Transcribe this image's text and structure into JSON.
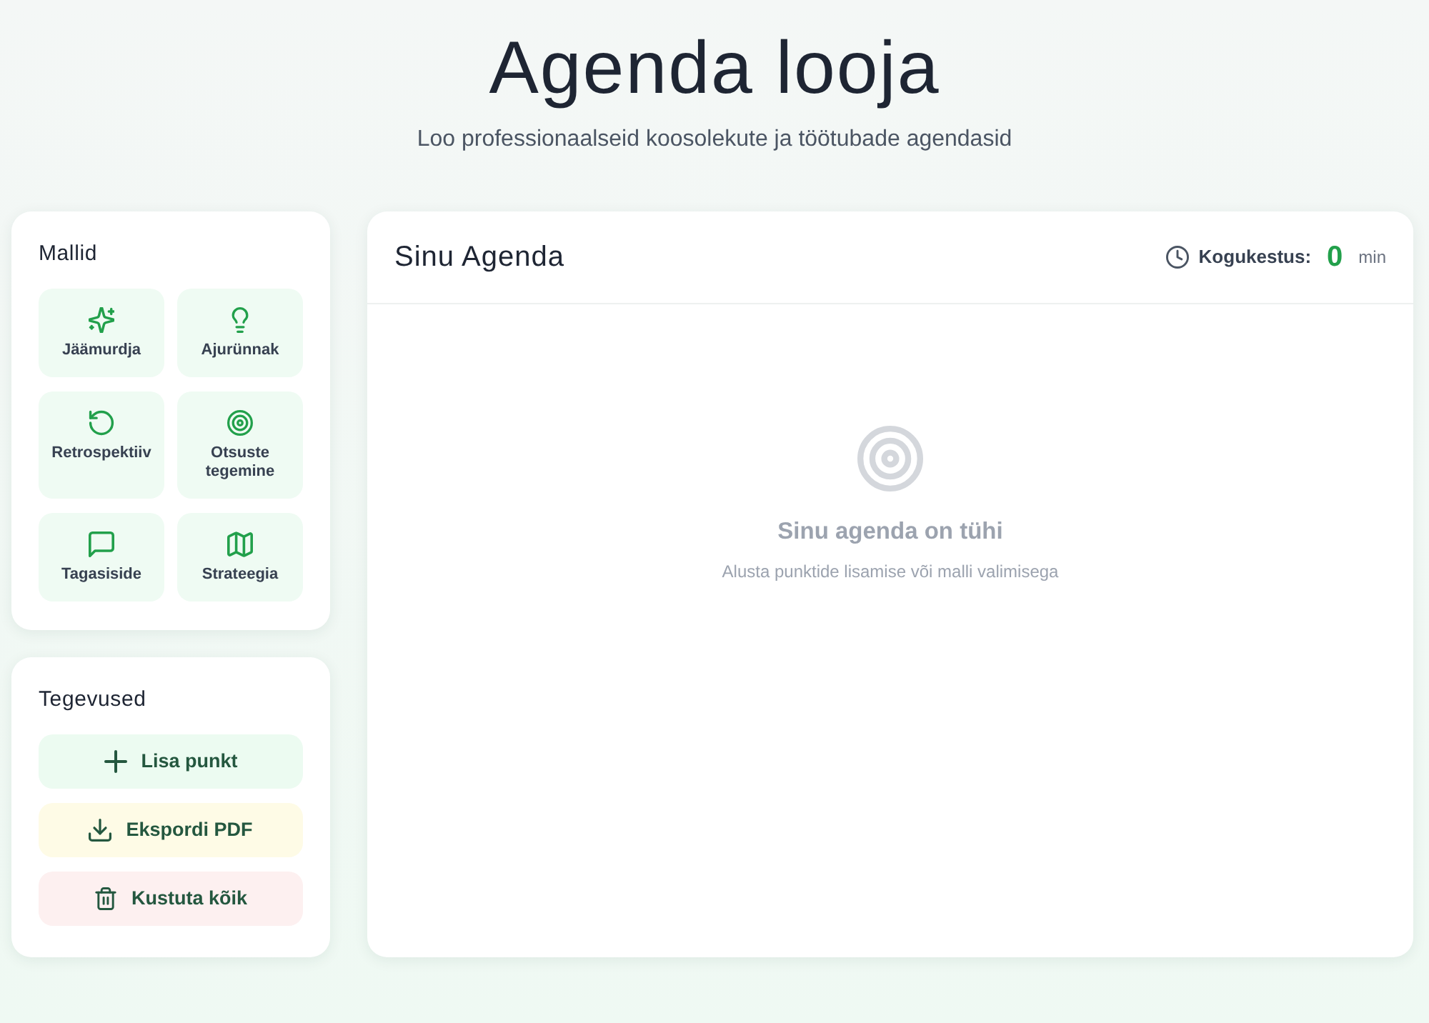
{
  "header": {
    "title": "Agenda looja",
    "subtitle": "Loo professionaalseid koosolekute ja töötubade agendasid"
  },
  "templates": {
    "title": "Mallid",
    "items": [
      {
        "label": "Jäämurdja",
        "kind": "sparkles"
      },
      {
        "label": "Ajurünnak",
        "kind": "bulb"
      },
      {
        "label": "Retrospektiiv",
        "kind": "rotate"
      },
      {
        "label": "Otsuste tegemine",
        "kind": "target"
      },
      {
        "label": "Tagasiside",
        "kind": "chat"
      },
      {
        "label": "Strateegia",
        "kind": "map"
      }
    ]
  },
  "actions": {
    "title": "Tegevused",
    "buttons": [
      {
        "label": "Lisa punkt",
        "kind": "add"
      },
      {
        "label": "Ekspordi PDF",
        "kind": "export"
      },
      {
        "label": "Kustuta kõik",
        "kind": "clear"
      }
    ]
  },
  "agenda": {
    "title": "Sinu Agenda",
    "total_label": "Kogukestus:",
    "total_value": "0",
    "total_unit": "min",
    "empty_title": "Sinu agenda on tühi",
    "empty_hint": "Alusta punktide lisamise või malli valimisega"
  }
}
